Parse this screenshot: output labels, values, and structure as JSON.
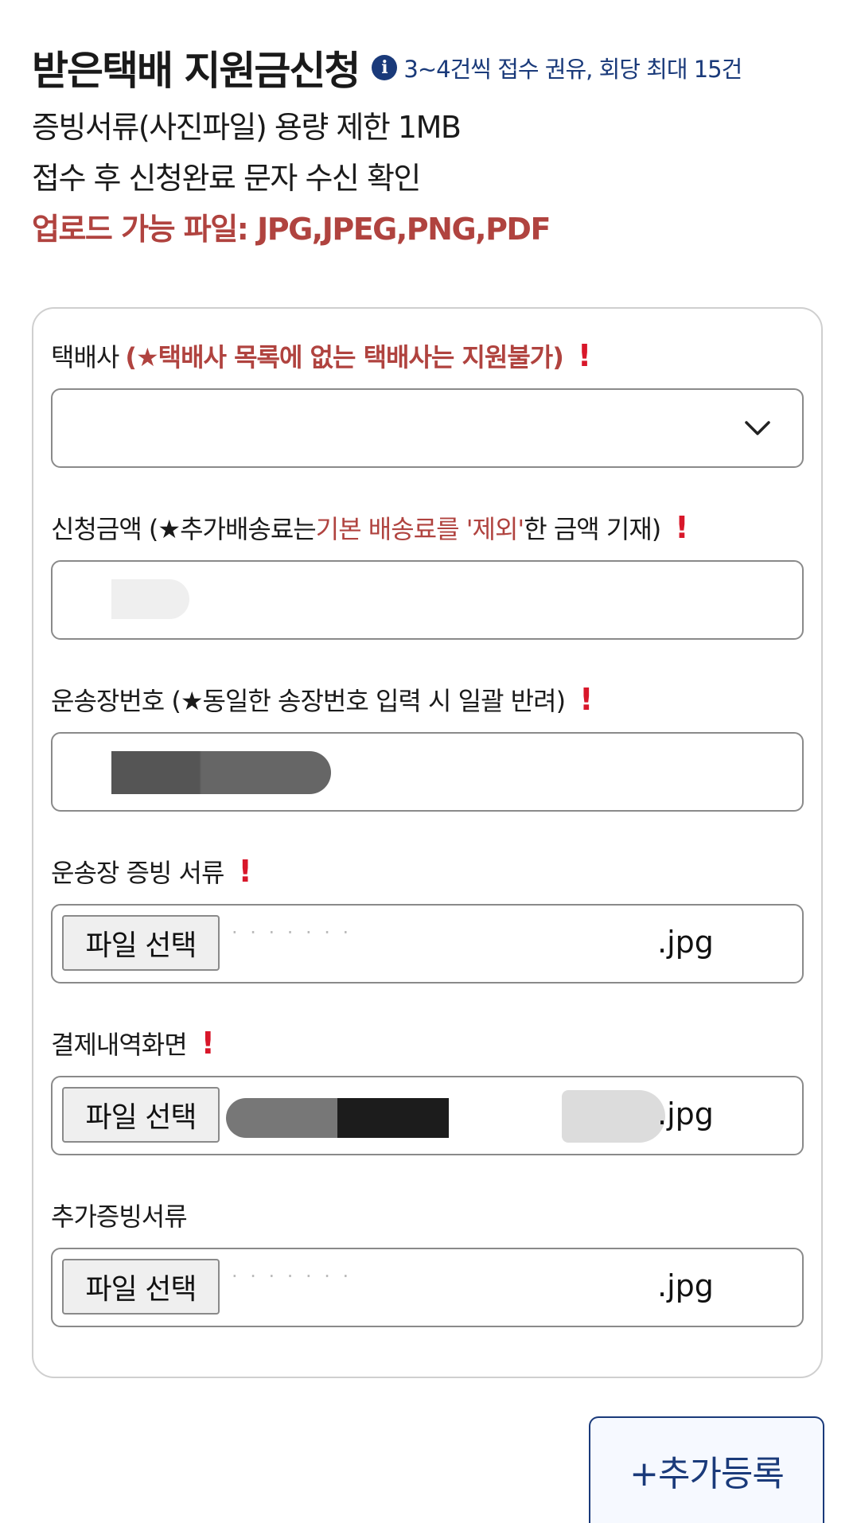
{
  "header": {
    "title": "받은택배 지원금신청",
    "info_text": "3~4건씩 접수 권유, 회당 최대 15건",
    "line1": "증빙서류(사진파일) 용량 제한 1MB",
    "line2": "접수 후 신청완료 문자 수신 확인",
    "line3": "업로드 가능 파일: JPG,JPEG,PNG,PDF"
  },
  "form": {
    "courier": {
      "label": "택배사",
      "note": "(★택배사 목록에 없는 택배사는 지원불가)",
      "required": "!",
      "selected_value": ""
    },
    "amount": {
      "label_prefix": "신청금액 (★추가배송료는 ",
      "label_highlight": "기본 배송료를 '제외'",
      "label_suffix": "한 금액 기재)",
      "required": "!"
    },
    "tracking": {
      "label": "운송장번호 (★동일한 송장번호 입력 시 일괄 반려)",
      "required": "!"
    },
    "waybill_doc": {
      "label": "운송장 증빙 서류",
      "required": "!",
      "button_label": "파일 선택",
      "file_ext": ".jpg"
    },
    "payment_screen": {
      "label": "결제내역화면",
      "required": "!",
      "button_label": "파일 선택",
      "file_ext": ".jpg"
    },
    "extra_doc": {
      "label": "추가증빙서류",
      "button_label": "파일 선택",
      "file_ext": ".jpg"
    }
  },
  "add_button": {
    "label": "+추가등록"
  },
  "colors": {
    "accent_red": "#b0433f",
    "required_red": "#d8172a",
    "navy": "#1a3a7a"
  },
  "icons": {
    "info": "info-icon",
    "select": "chevron-down-icon"
  }
}
